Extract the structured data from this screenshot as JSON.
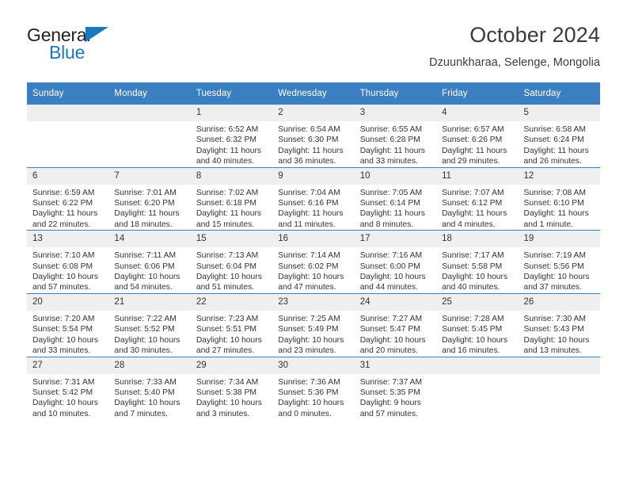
{
  "brand": {
    "name_top": "General",
    "name_bottom": "Blue",
    "accent_color": "#1878be",
    "triangle_icon": "triangle-icon"
  },
  "header": {
    "title": "October 2024",
    "subtitle": "Dzuunkharaa, Selenge, Mongolia"
  },
  "theme": {
    "header_bg": "#3a7fc1",
    "daynum_bg": "#efefef",
    "text": "#333333"
  },
  "calendar": {
    "weekday_headers": [
      "Sunday",
      "Monday",
      "Tuesday",
      "Wednesday",
      "Thursday",
      "Friday",
      "Saturday"
    ],
    "weeks": [
      [
        {
          "day": "",
          "blank": true,
          "sunrise": "",
          "sunset": "",
          "daylight": ""
        },
        {
          "day": "",
          "blank": true,
          "sunrise": "",
          "sunset": "",
          "daylight": ""
        },
        {
          "day": "1",
          "sunrise": "Sunrise: 6:52 AM",
          "sunset": "Sunset: 6:32 PM",
          "daylight": "Daylight: 11 hours and 40 minutes."
        },
        {
          "day": "2",
          "sunrise": "Sunrise: 6:54 AM",
          "sunset": "Sunset: 6:30 PM",
          "daylight": "Daylight: 11 hours and 36 minutes."
        },
        {
          "day": "3",
          "sunrise": "Sunrise: 6:55 AM",
          "sunset": "Sunset: 6:28 PM",
          "daylight": "Daylight: 11 hours and 33 minutes."
        },
        {
          "day": "4",
          "sunrise": "Sunrise: 6:57 AM",
          "sunset": "Sunset: 6:26 PM",
          "daylight": "Daylight: 11 hours and 29 minutes."
        },
        {
          "day": "5",
          "sunrise": "Sunrise: 6:58 AM",
          "sunset": "Sunset: 6:24 PM",
          "daylight": "Daylight: 11 hours and 26 minutes."
        }
      ],
      [
        {
          "day": "6",
          "sunrise": "Sunrise: 6:59 AM",
          "sunset": "Sunset: 6:22 PM",
          "daylight": "Daylight: 11 hours and 22 minutes."
        },
        {
          "day": "7",
          "sunrise": "Sunrise: 7:01 AM",
          "sunset": "Sunset: 6:20 PM",
          "daylight": "Daylight: 11 hours and 18 minutes."
        },
        {
          "day": "8",
          "sunrise": "Sunrise: 7:02 AM",
          "sunset": "Sunset: 6:18 PM",
          "daylight": "Daylight: 11 hours and 15 minutes."
        },
        {
          "day": "9",
          "sunrise": "Sunrise: 7:04 AM",
          "sunset": "Sunset: 6:16 PM",
          "daylight": "Daylight: 11 hours and 11 minutes."
        },
        {
          "day": "10",
          "sunrise": "Sunrise: 7:05 AM",
          "sunset": "Sunset: 6:14 PM",
          "daylight": "Daylight: 11 hours and 8 minutes."
        },
        {
          "day": "11",
          "sunrise": "Sunrise: 7:07 AM",
          "sunset": "Sunset: 6:12 PM",
          "daylight": "Daylight: 11 hours and 4 minutes."
        },
        {
          "day": "12",
          "sunrise": "Sunrise: 7:08 AM",
          "sunset": "Sunset: 6:10 PM",
          "daylight": "Daylight: 11 hours and 1 minute."
        }
      ],
      [
        {
          "day": "13",
          "sunrise": "Sunrise: 7:10 AM",
          "sunset": "Sunset: 6:08 PM",
          "daylight": "Daylight: 10 hours and 57 minutes."
        },
        {
          "day": "14",
          "sunrise": "Sunrise: 7:11 AM",
          "sunset": "Sunset: 6:06 PM",
          "daylight": "Daylight: 10 hours and 54 minutes."
        },
        {
          "day": "15",
          "sunrise": "Sunrise: 7:13 AM",
          "sunset": "Sunset: 6:04 PM",
          "daylight": "Daylight: 10 hours and 51 minutes."
        },
        {
          "day": "16",
          "sunrise": "Sunrise: 7:14 AM",
          "sunset": "Sunset: 6:02 PM",
          "daylight": "Daylight: 10 hours and 47 minutes."
        },
        {
          "day": "17",
          "sunrise": "Sunrise: 7:16 AM",
          "sunset": "Sunset: 6:00 PM",
          "daylight": "Daylight: 10 hours and 44 minutes."
        },
        {
          "day": "18",
          "sunrise": "Sunrise: 7:17 AM",
          "sunset": "Sunset: 5:58 PM",
          "daylight": "Daylight: 10 hours and 40 minutes."
        },
        {
          "day": "19",
          "sunrise": "Sunrise: 7:19 AM",
          "sunset": "Sunset: 5:56 PM",
          "daylight": "Daylight: 10 hours and 37 minutes."
        }
      ],
      [
        {
          "day": "20",
          "sunrise": "Sunrise: 7:20 AM",
          "sunset": "Sunset: 5:54 PM",
          "daylight": "Daylight: 10 hours and 33 minutes."
        },
        {
          "day": "21",
          "sunrise": "Sunrise: 7:22 AM",
          "sunset": "Sunset: 5:52 PM",
          "daylight": "Daylight: 10 hours and 30 minutes."
        },
        {
          "day": "22",
          "sunrise": "Sunrise: 7:23 AM",
          "sunset": "Sunset: 5:51 PM",
          "daylight": "Daylight: 10 hours and 27 minutes."
        },
        {
          "day": "23",
          "sunrise": "Sunrise: 7:25 AM",
          "sunset": "Sunset: 5:49 PM",
          "daylight": "Daylight: 10 hours and 23 minutes."
        },
        {
          "day": "24",
          "sunrise": "Sunrise: 7:27 AM",
          "sunset": "Sunset: 5:47 PM",
          "daylight": "Daylight: 10 hours and 20 minutes."
        },
        {
          "day": "25",
          "sunrise": "Sunrise: 7:28 AM",
          "sunset": "Sunset: 5:45 PM",
          "daylight": "Daylight: 10 hours and 16 minutes."
        },
        {
          "day": "26",
          "sunrise": "Sunrise: 7:30 AM",
          "sunset": "Sunset: 5:43 PM",
          "daylight": "Daylight: 10 hours and 13 minutes."
        }
      ],
      [
        {
          "day": "27",
          "sunrise": "Sunrise: 7:31 AM",
          "sunset": "Sunset: 5:42 PM",
          "daylight": "Daylight: 10 hours and 10 minutes."
        },
        {
          "day": "28",
          "sunrise": "Sunrise: 7:33 AM",
          "sunset": "Sunset: 5:40 PM",
          "daylight": "Daylight: 10 hours and 7 minutes."
        },
        {
          "day": "29",
          "sunrise": "Sunrise: 7:34 AM",
          "sunset": "Sunset: 5:38 PM",
          "daylight": "Daylight: 10 hours and 3 minutes."
        },
        {
          "day": "30",
          "sunrise": "Sunrise: 7:36 AM",
          "sunset": "Sunset: 5:36 PM",
          "daylight": "Daylight: 10 hours and 0 minutes."
        },
        {
          "day": "31",
          "sunrise": "Sunrise: 7:37 AM",
          "sunset": "Sunset: 5:35 PM",
          "daylight": "Daylight: 9 hours and 57 minutes."
        },
        {
          "day": "",
          "blank": true,
          "sunrise": "",
          "sunset": "",
          "daylight": ""
        },
        {
          "day": "",
          "blank": true,
          "sunrise": "",
          "sunset": "",
          "daylight": ""
        }
      ]
    ]
  }
}
